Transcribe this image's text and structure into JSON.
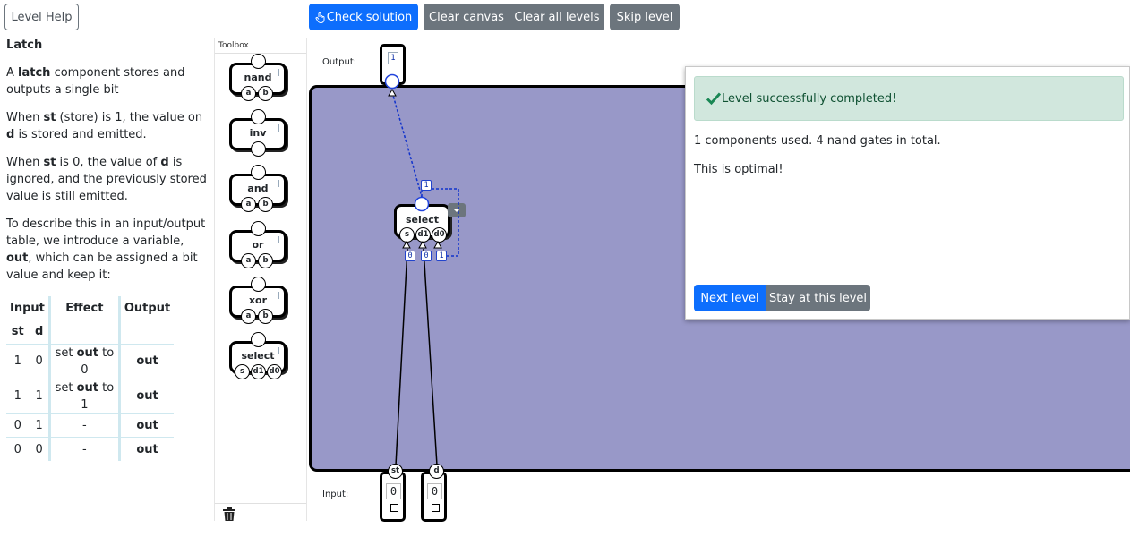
{
  "toolbar": {
    "level_help": "Level Help",
    "check_solution": "Check solution",
    "clear_canvas": "Clear canvas",
    "clear_all_levels": "Clear all levels",
    "skip_level": "Skip level"
  },
  "help": {
    "title": "Latch",
    "p1": [
      "A ",
      "latch",
      " component stores and outputs a single bit"
    ],
    "p2": [
      "When ",
      "st",
      " (store) is 1, the value on ",
      "d",
      " is stored and emitted."
    ],
    "p3": [
      "When ",
      "st",
      " is 0, the value of ",
      "d",
      " is ignored, and the previously stored value is still emitted."
    ],
    "p4": [
      "To describe this in an input/output table, we introduce a variable, ",
      "out",
      ", which can be assigned a bit value and keep it:"
    ],
    "table": {
      "headers": [
        "Input",
        "Effect",
        "Output"
      ],
      "subheaders": [
        "st",
        "d"
      ],
      "rows": [
        {
          "st": "1",
          "d": "0",
          "effect_pre": "set ",
          "effect_var": "out",
          "effect_post": " to 0",
          "output": "out"
        },
        {
          "st": "1",
          "d": "1",
          "effect_pre": "set ",
          "effect_var": "out",
          "effect_post": " to 1",
          "output": "out"
        },
        {
          "st": "0",
          "d": "1",
          "effect_pre": "-",
          "effect_var": "",
          "effect_post": "",
          "output": "out"
        },
        {
          "st": "0",
          "d": "0",
          "effect_pre": "-",
          "effect_var": "",
          "effect_post": "",
          "output": "out"
        }
      ]
    }
  },
  "toolbox": {
    "title": "Toolbox",
    "items": [
      {
        "label": "nand",
        "pins": [
          "a",
          "b"
        ]
      },
      {
        "label": "inv",
        "pins": []
      },
      {
        "label": "and",
        "pins": [
          "a",
          "b"
        ]
      },
      {
        "label": "or",
        "pins": [
          "a",
          "b"
        ]
      },
      {
        "label": "xor",
        "pins": [
          "a",
          "b"
        ]
      },
      {
        "label": "select",
        "pins": [
          "s",
          "d1",
          "d0"
        ]
      }
    ]
  },
  "canvas": {
    "output_label": "Output:",
    "input_label": "Input:",
    "output_value": "1",
    "select_component": {
      "label": "select",
      "pins": [
        "s",
        "d1",
        "d0"
      ],
      "out_value": "1",
      "pin_values": [
        "0",
        "0",
        "1"
      ]
    },
    "inputs": [
      {
        "name": "st",
        "value": "0"
      },
      {
        "name": "d",
        "value": "0"
      }
    ]
  },
  "popup": {
    "success": "Level successfully completed!",
    "components": "1 components used. 4 nand gates in total.",
    "optimal": "This is optimal!",
    "next_level": "Next level",
    "stay": "Stay at this level"
  },
  "colors": {
    "primary": "#0d6efd",
    "secondary": "#6c757d",
    "board": "#9898c8",
    "success_bg": "#d1e7dd",
    "success_text": "#0f5132",
    "wire_active": "#1133cc"
  }
}
